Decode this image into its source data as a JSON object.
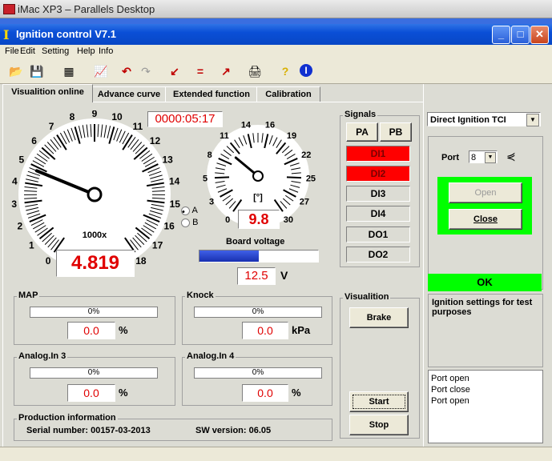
{
  "mac": {
    "title": "iMac XP3 – Parallels Desktop"
  },
  "window": {
    "title": "Ignition control  V7.1"
  },
  "menu": [
    "File",
    "Edit",
    "Setting",
    "Help",
    "Info"
  ],
  "tabs": [
    "Visualition online",
    "Advance curve",
    "Extended function",
    "Calibration"
  ],
  "timer": "0000:05:17",
  "rpm_gauge": {
    "ticks": [
      "0",
      "1",
      "2",
      "3",
      "4",
      "5",
      "6",
      "7",
      "8",
      "9",
      "10",
      "11",
      "12",
      "13",
      "14",
      "15",
      "16",
      "17",
      "18"
    ],
    "unit": "1000x",
    "value": "4.819",
    "needle": 4.8
  },
  "angle_gauge": {
    "ticks": [
      "0",
      "3",
      "5",
      "8",
      "11",
      "14",
      "16",
      "19",
      "22",
      "25",
      "27",
      "30"
    ],
    "unit": "[°]",
    "value": "9.8",
    "needle": 9.8
  },
  "radio": {
    "a": "A",
    "b": "B"
  },
  "board_voltage": {
    "label": "Board voltage",
    "value": "12.5",
    "unit": "V",
    "fill": 0.5
  },
  "signals": {
    "title": "Signals",
    "pa": "PA",
    "pb": "PB",
    "items": [
      "DI1",
      "DI2",
      "DI3",
      "DI4",
      "DO1",
      "DO2"
    ]
  },
  "map": {
    "title": "MAP",
    "pct": "0%",
    "value": "0.0",
    "unit": "%"
  },
  "knock": {
    "title": "Knock",
    "pct": "0%",
    "value": "0.0",
    "unit": "kPa"
  },
  "analog3": {
    "title": "Analog.In 3",
    "pct": "0%",
    "value": "0.0",
    "unit": "%"
  },
  "analog4": {
    "title": "Analog.In 4",
    "pct": "0%",
    "value": "0.0",
    "unit": "%"
  },
  "visualition": {
    "title": "Visualition",
    "brake": "Brake",
    "start": "Start",
    "stop": "Stop"
  },
  "production": {
    "title": "Production information",
    "serial": "Serial number:  00157-03-2013",
    "sw": "SW version:  06.05"
  },
  "right": {
    "mode": "Direct Ignition TCI",
    "port_label": "Port",
    "port_value": "8",
    "open": "Open",
    "close": "Close",
    "status": "OK",
    "info": "Ignition settings for test purposes",
    "log": [
      "Port open",
      "Port close",
      "Port open"
    ]
  },
  "colors": {
    "accent_green": "#00ff00",
    "signal_on": "#ff0000",
    "bar_fill": "#2040c0"
  }
}
